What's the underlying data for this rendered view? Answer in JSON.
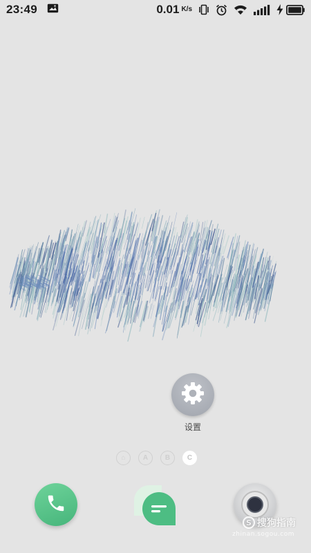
{
  "status_bar": {
    "time": "23:49",
    "net_speed": "0.01",
    "net_unit": "K/s",
    "icons": [
      "screenshot-notification-icon",
      "vibrate-icon",
      "alarm-icon",
      "wifi-icon",
      "signal-icon",
      "charging-icon",
      "battery-icon"
    ]
  },
  "home": {
    "apps": [
      {
        "label": "设置",
        "icon": "gear-icon",
        "color": "#a9adb5"
      }
    ],
    "page_indicator": [
      {
        "glyph": "⌂",
        "active": false
      },
      {
        "glyph": "A",
        "active": false
      },
      {
        "glyph": "B",
        "active": false
      },
      {
        "glyph": "C",
        "active": true
      }
    ]
  },
  "dock": {
    "items": [
      {
        "name": "phone",
        "icon": "phone-icon",
        "color": "#4cbc82"
      },
      {
        "name": "messages",
        "icon": "message-icon",
        "color": "#4cbc82"
      },
      {
        "name": "camera",
        "icon": "camera-icon",
        "color": "#2e3240"
      }
    ]
  },
  "watermark": {
    "text": "搜狗指南",
    "sub": "zhinan.sogou.com"
  }
}
